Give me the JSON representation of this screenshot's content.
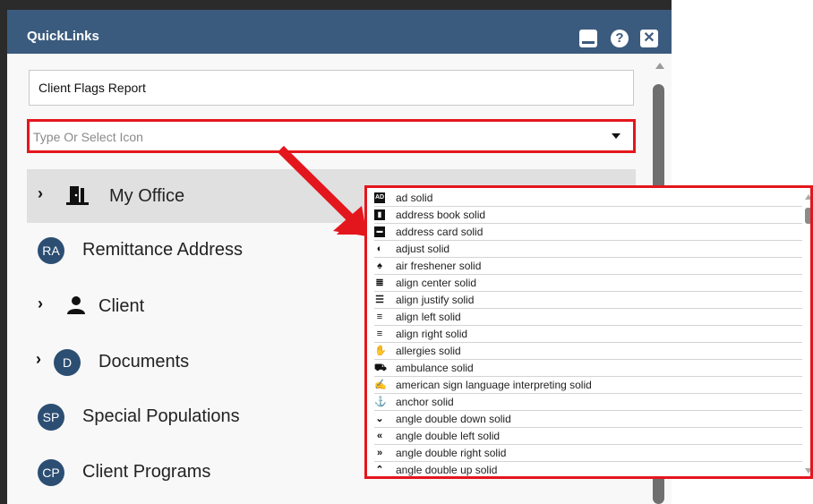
{
  "header": {
    "title": "QuickLinks"
  },
  "form": {
    "name_value": "Client Flags Report",
    "icon_placeholder": "Type Or Select Icon"
  },
  "nav": [
    {
      "label": "My Office",
      "badge": "",
      "expandable": true
    },
    {
      "label": "Remittance Address",
      "badge": "RA",
      "expandable": false
    },
    {
      "label": "Client",
      "badge": "",
      "expandable": true
    },
    {
      "label": "Documents",
      "badge": "D",
      "expandable": true
    },
    {
      "label": "Special Populations",
      "badge": "SP",
      "expandable": false
    },
    {
      "label": "Client Programs",
      "badge": "CP",
      "expandable": false
    }
  ],
  "icon_dropdown": {
    "options": [
      {
        "label": "ad solid",
        "icon": "ad-icon"
      },
      {
        "label": "address book solid",
        "icon": "address-book-icon"
      },
      {
        "label": "address card solid",
        "icon": "address-card-icon"
      },
      {
        "label": "adjust solid",
        "icon": "adjust-icon"
      },
      {
        "label": "air freshener solid",
        "icon": "air-freshener-icon"
      },
      {
        "label": "align center solid",
        "icon": "align-center-icon"
      },
      {
        "label": "align justify solid",
        "icon": "align-justify-icon"
      },
      {
        "label": "align left solid",
        "icon": "align-left-icon"
      },
      {
        "label": "align right solid",
        "icon": "align-right-icon"
      },
      {
        "label": "allergies solid",
        "icon": "allergies-icon"
      },
      {
        "label": "ambulance solid",
        "icon": "ambulance-icon"
      },
      {
        "label": "american sign language interpreting solid",
        "icon": "asl-icon"
      },
      {
        "label": "anchor solid",
        "icon": "anchor-icon"
      },
      {
        "label": "angle double down solid",
        "icon": "angle-double-down-icon"
      },
      {
        "label": "angle double left solid",
        "icon": "angle-double-left-icon"
      },
      {
        "label": "angle double right solid",
        "icon": "angle-double-right-icon"
      },
      {
        "label": "angle double up solid",
        "icon": "angle-double-up-icon"
      }
    ]
  },
  "colors": {
    "header": "#3b5b7e",
    "badge": "#2c4e73",
    "highlight": "#e4161d"
  }
}
